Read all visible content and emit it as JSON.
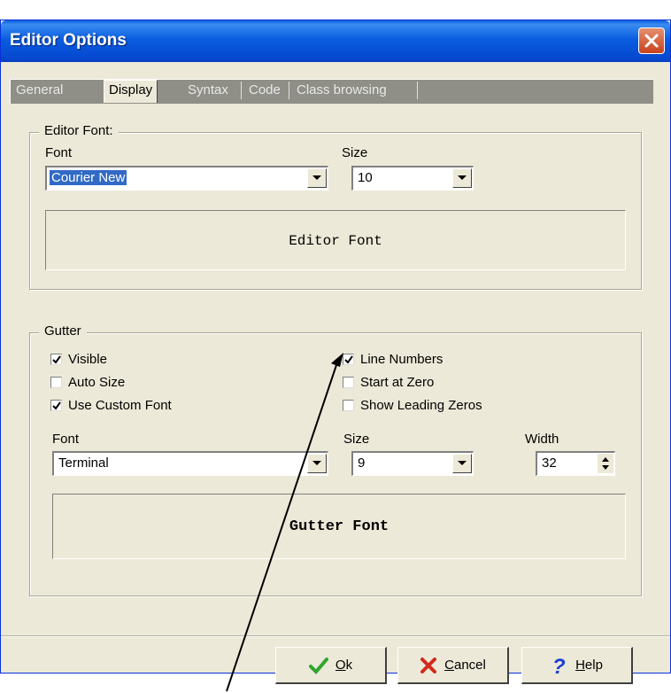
{
  "window": {
    "title": "Editor Options"
  },
  "tabs": [
    {
      "label": "General"
    },
    {
      "label": "Display"
    },
    {
      "label": "Syntax"
    },
    {
      "label": "Code"
    },
    {
      "label": "Class browsing"
    }
  ],
  "editor_font": {
    "legend": "Editor Font:",
    "font_label": "Font",
    "font_value": "Courier New",
    "size_label": "Size",
    "size_value": "10",
    "preview": "Editor Font"
  },
  "gutter": {
    "legend": "Gutter",
    "checkboxes": [
      {
        "label": "Visible",
        "checked": true
      },
      {
        "label": "Auto Size",
        "checked": false
      },
      {
        "label": "Use Custom Font",
        "checked": true
      },
      {
        "label": "Line Numbers",
        "checked": true
      },
      {
        "label": "Start at Zero",
        "checked": false
      },
      {
        "label": "Show Leading Zeros",
        "checked": false
      }
    ],
    "font_label": "Font",
    "font_value": "Terminal",
    "size_label": "Size",
    "size_value": "9",
    "width_label": "Width",
    "width_value": "32",
    "preview": "Gutter Font"
  },
  "buttons": {
    "ok": {
      "underline": "O",
      "rest": "k"
    },
    "cancel": {
      "underline": "C",
      "rest": "ancel"
    },
    "help": {
      "underline": "H",
      "rest": "elp"
    }
  },
  "colors": {
    "titlebar": "#0a5de0",
    "selection": "#316ac5",
    "ok_check": "#2ea52e",
    "cancel_x": "#d22a1c",
    "help_q": "#1c3fd2"
  }
}
